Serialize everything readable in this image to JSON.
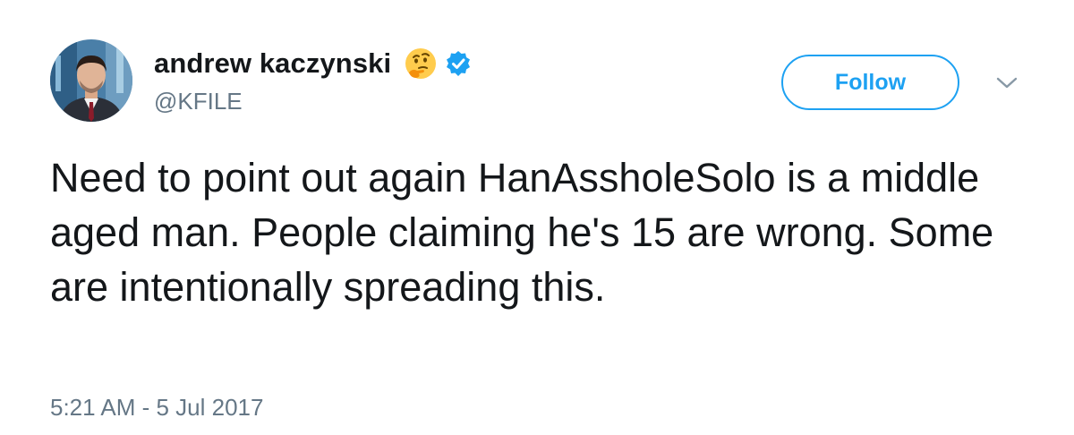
{
  "tweet": {
    "author": {
      "display_name": "andrew kaczynski",
      "handle": "@KFILE",
      "name_emoji": "thinking-face-emoji",
      "verified": true,
      "avatar": "profile-photo"
    },
    "follow_label": "Follow",
    "menu_icon": "chevron-down-icon",
    "text": "Need to point out again HanAssholeSolo is a middle aged man. People claiming he's 15 are wrong. Some are intentionally spreading this.",
    "timestamp": "5:21 AM - 5 Jul 2017"
  },
  "colors": {
    "accent": "#1da1f2",
    "text": "#14171a",
    "secondary_text": "#657786"
  }
}
